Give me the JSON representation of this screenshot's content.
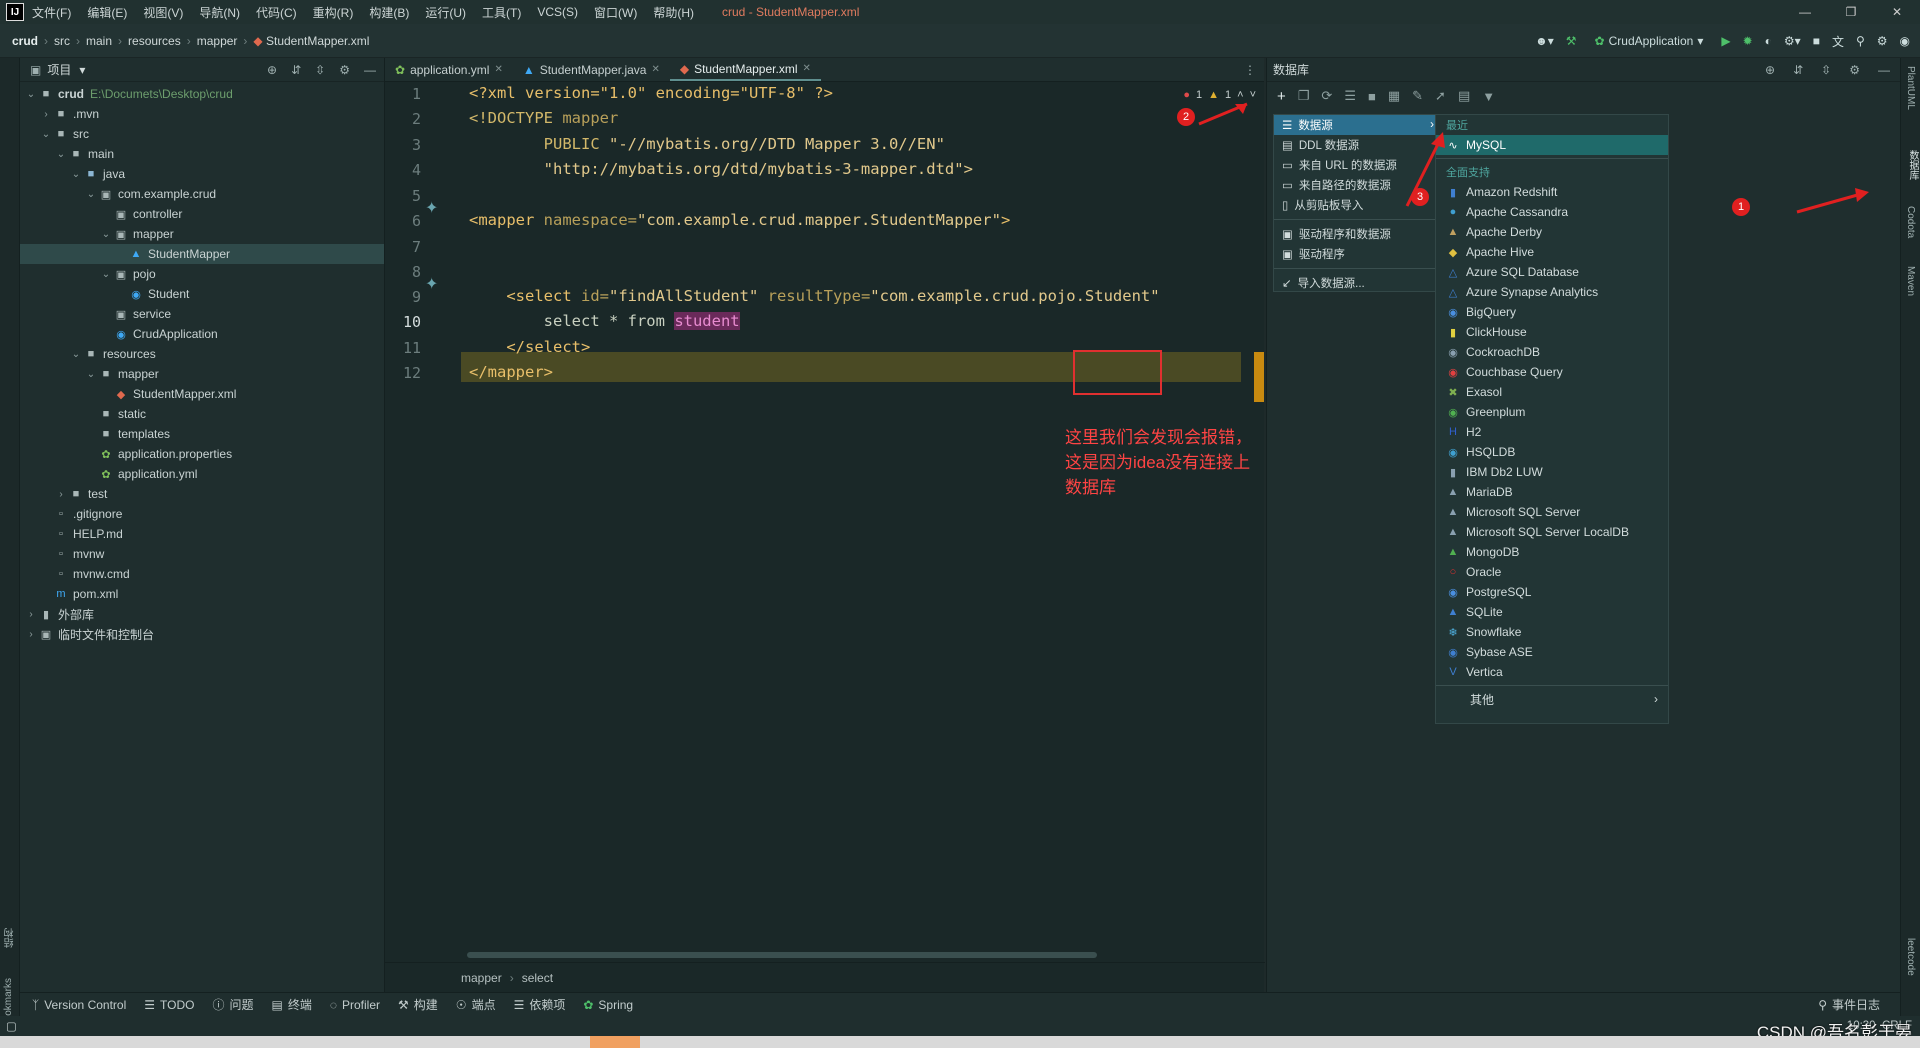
{
  "menubar": {
    "logo": "IJ",
    "items": [
      "文件(F)",
      "编辑(E)",
      "视图(V)",
      "导航(N)",
      "代码(C)",
      "重构(R)",
      "构建(B)",
      "运行(U)",
      "工具(T)",
      "VCS(S)",
      "窗口(W)",
      "帮助(H)"
    ],
    "title": "crud - StudentMapper.xml"
  },
  "breadcrumb": [
    "crud",
    "src",
    "main",
    "resources",
    "mapper",
    "StudentMapper.xml"
  ],
  "run_config": "CrudApplication",
  "project_panel": {
    "title": "项目",
    "tree": [
      {
        "label": "crud",
        "path": "E:\\Documets\\Desktop\\crud",
        "icon": "folder-icon",
        "level": 0,
        "arrow": "down"
      },
      {
        "label": ".mvn",
        "icon": "folder-icon",
        "level": 1,
        "arrow": "right"
      },
      {
        "label": "src",
        "icon": "folder-icon",
        "level": 1,
        "arrow": "down"
      },
      {
        "label": "main",
        "icon": "folder-icon",
        "level": 2,
        "arrow": "down"
      },
      {
        "label": "java",
        "icon": "source-folder-icon",
        "level": 3,
        "arrow": "down"
      },
      {
        "label": "com.example.crud",
        "icon": "package-icon",
        "level": 4,
        "arrow": "down"
      },
      {
        "label": "controller",
        "icon": "package-icon",
        "level": 5,
        "arrow": ""
      },
      {
        "label": "mapper",
        "icon": "package-icon",
        "level": 5,
        "arrow": "down"
      },
      {
        "label": "StudentMapper",
        "icon": "mybatis-icon",
        "level": 6,
        "arrow": "",
        "selected": true
      },
      {
        "label": "pojo",
        "icon": "package-icon",
        "level": 5,
        "arrow": "down"
      },
      {
        "label": "Student",
        "icon": "class-icon",
        "level": 6,
        "arrow": ""
      },
      {
        "label": "service",
        "icon": "package-icon",
        "level": 5,
        "arrow": ""
      },
      {
        "label": "CrudApplication",
        "icon": "spring-class-icon",
        "level": 5,
        "arrow": ""
      },
      {
        "label": "resources",
        "icon": "resources-folder-icon",
        "level": 3,
        "arrow": "down"
      },
      {
        "label": "mapper",
        "icon": "folder-icon",
        "level": 4,
        "arrow": "down"
      },
      {
        "label": "StudentMapper.xml",
        "icon": "xml-file-icon",
        "level": 5,
        "arrow": ""
      },
      {
        "label": "static",
        "icon": "folder-icon",
        "level": 4,
        "arrow": ""
      },
      {
        "label": "templates",
        "icon": "folder-icon",
        "level": 4,
        "arrow": ""
      },
      {
        "label": "application.properties",
        "icon": "spring-config-icon",
        "level": 4,
        "arrow": ""
      },
      {
        "label": "application.yml",
        "icon": "spring-config-icon",
        "level": 4,
        "arrow": ""
      },
      {
        "label": "test",
        "icon": "folder-icon",
        "level": 2,
        "arrow": "right"
      },
      {
        "label": ".gitignore",
        "icon": "file-icon",
        "level": 1,
        "arrow": ""
      },
      {
        "label": "HELP.md",
        "icon": "markdown-icon",
        "level": 1,
        "arrow": ""
      },
      {
        "label": "mvnw",
        "icon": "file-icon",
        "level": 1,
        "arrow": ""
      },
      {
        "label": "mvnw.cmd",
        "icon": "file-icon",
        "level": 1,
        "arrow": ""
      },
      {
        "label": "pom.xml",
        "icon": "maven-icon",
        "level": 1,
        "arrow": ""
      },
      {
        "label": "外部库",
        "icon": "library-icon",
        "level": 0,
        "arrow": "right"
      },
      {
        "label": "临时文件和控制台",
        "icon": "scratch-icon",
        "level": 0,
        "arrow": "right"
      }
    ]
  },
  "editor": {
    "tabs": [
      {
        "label": "application.yml",
        "icon": "spring-config-icon"
      },
      {
        "label": "StudentMapper.java",
        "icon": "mybatis-icon"
      },
      {
        "label": "StudentMapper.xml",
        "icon": "xml-file-icon",
        "active": true
      }
    ],
    "errors": "1",
    "warnings": "1",
    "line_numbers": [
      "1",
      "2",
      "3",
      "4",
      "5",
      "6",
      "7",
      "8",
      "9",
      "10",
      "11",
      "12"
    ],
    "current_line": "10",
    "lines": {
      "l1": "<?xml version=\"1.0\" encoding=\"UTF-8\" ?>",
      "l2a": "<!DOCTYPE",
      "l2b": " mapper",
      "l3a": "        PUBLIC ",
      "l3b": "\"-//mybatis.org//DTD Mapper 3.0//EN\"",
      "l4": "        \"http://mybatis.org/dtd/mybatis-3-mapper.dtd\">",
      "l6a": "<mapper",
      "l6b": " namespace=",
      "l6c": "\"com.example.crud.mapper.StudentMapper\"",
      "l6d": ">",
      "l9a": "    <select",
      "l9b": " id=",
      "l9c": "\"findAllStudent\"",
      "l9d": " resultType=",
      "l9e": "\"com.example.crud.pojo.Student\"",
      "l10a": "        select * from ",
      "l10b": "student",
      "l11": "    </select>",
      "l12": "</mapper>"
    },
    "annotation": "这里我们会发现会报错，这是因为idea没有连接上数据库",
    "breadcrumb": [
      "mapper",
      "select"
    ]
  },
  "db_panel": {
    "title": "数据库",
    "menu": [
      {
        "label": "数据源",
        "icon": "datasource-icon",
        "selected": true,
        "submenu": true
      },
      {
        "label": "DDL 数据源",
        "icon": "ddl-icon"
      },
      {
        "label": "来自 URL 的数据源",
        "icon": "url-icon"
      },
      {
        "label": "来自路径的数据源",
        "icon": "path-icon"
      },
      {
        "label": "从剪贴板导入",
        "icon": "clipboard-icon"
      },
      {
        "label": "驱动程序和数据源",
        "icon": "driver-icon"
      },
      {
        "label": "驱动程序",
        "icon": "driver-icon"
      },
      {
        "label": "导入数据源...",
        "icon": "import-icon"
      }
    ],
    "recent_header": "最近",
    "recent": [
      "MySQL"
    ],
    "full_header": "全面支持",
    "drivers": [
      "Amazon Redshift",
      "Apache Cassandra",
      "Apache Derby",
      "Apache Hive",
      "Azure SQL Database",
      "Azure Synapse Analytics",
      "BigQuery",
      "ClickHouse",
      "CockroachDB",
      "Couchbase Query",
      "Exasol",
      "Greenplum",
      "H2",
      "HSQLDB",
      "IBM Db2 LUW",
      "MariaDB",
      "Microsoft SQL Server",
      "Microsoft SQL Server LocalDB",
      "MongoDB",
      "Oracle",
      "PostgreSQL",
      "SQLite",
      "Snowflake",
      "Sybase ASE",
      "Vertica"
    ],
    "other": "其他"
  },
  "callouts": [
    "1",
    "2",
    "3"
  ],
  "left_strip": [
    "结构",
    "Bookmarks"
  ],
  "right_strip": [
    "PlantUML",
    "数据库",
    "Codota",
    "Maven",
    "leetcode"
  ],
  "bottom_tools": [
    {
      "label": "Version Control",
      "icon": "branch-icon"
    },
    {
      "label": "TODO",
      "icon": "list-icon"
    },
    {
      "label": "问题",
      "icon": "info-icon"
    },
    {
      "label": "终端",
      "icon": "terminal-icon"
    },
    {
      "label": "Profiler",
      "icon": "profiler-icon"
    },
    {
      "label": "构建",
      "icon": "hammer-icon"
    },
    {
      "label": "端点",
      "icon": "endpoints-icon"
    },
    {
      "label": "依赖项",
      "icon": "layers-icon"
    },
    {
      "label": "Spring",
      "icon": "spring-icon"
    }
  ],
  "event_log": "事件日志",
  "status": {
    "position": "10:30",
    "line_sep": "CRLF"
  },
  "watermark": "CSDN @吾名彭于晏",
  "colors": {
    "accent": "#2b6f8f",
    "annotation_red": "#e03030"
  }
}
